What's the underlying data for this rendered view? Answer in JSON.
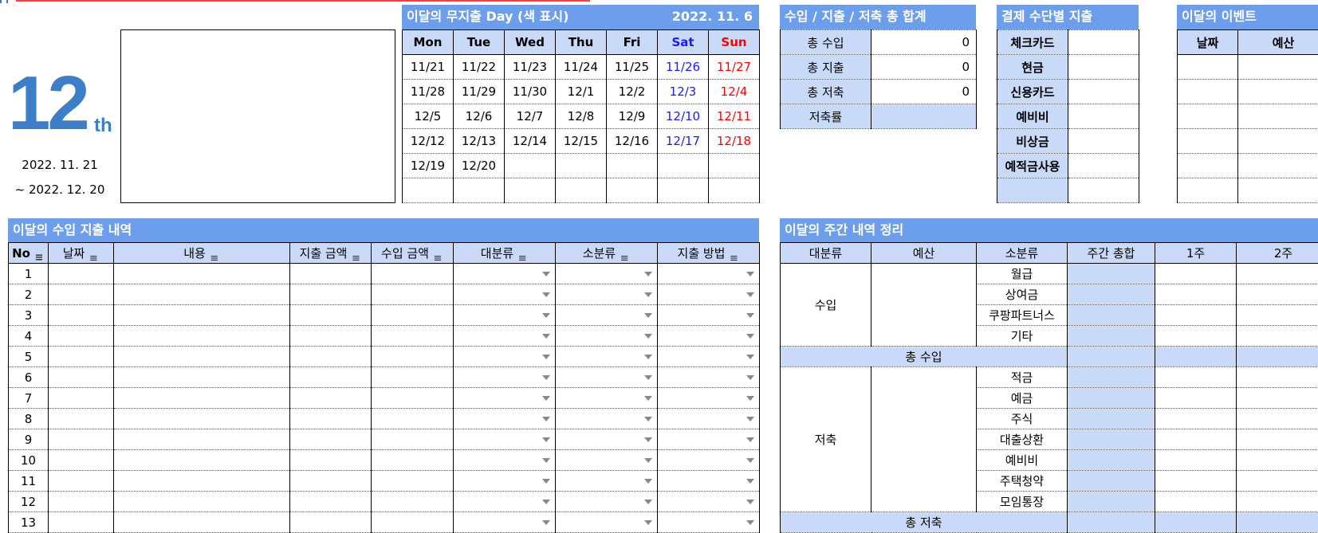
{
  "month": {
    "number": "12",
    "suffix": "th",
    "start": "2022. 11. 21",
    "end": "~ 2022. 12. 20"
  },
  "calendar": {
    "title": "이달의  무지출 Day (색 표시)",
    "date": "2022. 11. 6",
    "days": [
      "Mon",
      "Tue",
      "Wed",
      "Thu",
      "Fri",
      "Sat",
      "Sun"
    ],
    "weeks": [
      [
        "11/21",
        "11/22",
        "11/23",
        "11/24",
        "11/25",
        "11/26",
        "11/27"
      ],
      [
        "11/28",
        "11/29",
        "11/30",
        "12/1",
        "12/2",
        "12/3",
        "12/4"
      ],
      [
        "12/5",
        "12/6",
        "12/7",
        "12/8",
        "12/9",
        "12/10",
        "12/11"
      ],
      [
        "12/12",
        "12/13",
        "12/14",
        "12/15",
        "12/16",
        "12/17",
        "12/18"
      ],
      [
        "12/19",
        "12/20",
        "",
        "",
        "",
        "",
        ""
      ],
      [
        "",
        "",
        "",
        "",
        "",
        "",
        ""
      ]
    ]
  },
  "totals": {
    "title": "수입 / 지출 / 저축 총 합계",
    "rows": [
      {
        "label": "총 수입",
        "value": "0"
      },
      {
        "label": "총 지출",
        "value": "0"
      },
      {
        "label": "총 저축",
        "value": "0"
      },
      {
        "label": "저축률",
        "value": ""
      }
    ]
  },
  "payment": {
    "title": "결제 수단별 지출",
    "rows": [
      "체크카드",
      "현금",
      "신용카드",
      "예비비",
      "비상금",
      "예적금사용",
      ""
    ]
  },
  "events": {
    "title": "이달의 이벤트",
    "headers": [
      "날짜",
      "예산"
    ]
  },
  "ledger": {
    "title": "이달의 수입 지출 내역",
    "headers": [
      "No",
      "날짜",
      "내용",
      "지출 금액",
      "수입 금액",
      "대분류",
      "소분류",
      "지출 방법"
    ],
    "rows": [
      "1",
      "2",
      "3",
      "4",
      "5",
      "6",
      "7",
      "8",
      "9",
      "10",
      "11",
      "12",
      "13"
    ]
  },
  "weekly": {
    "title": "이달의 주간 내역 정리",
    "headers": [
      "대분류",
      "예산",
      "소분류",
      "주간 총합",
      "1주",
      "2주"
    ],
    "income_label": "수입",
    "income_items": [
      "월급",
      "상여금",
      "쿠팡파트너스",
      "기타"
    ],
    "income_total": "총 수입",
    "savings_label": "저축",
    "savings_items": [
      "적금",
      "예금",
      "주식",
      "대출상환",
      "예비비",
      "주택청약",
      "모임통장"
    ],
    "savings_total": "총 저축"
  }
}
